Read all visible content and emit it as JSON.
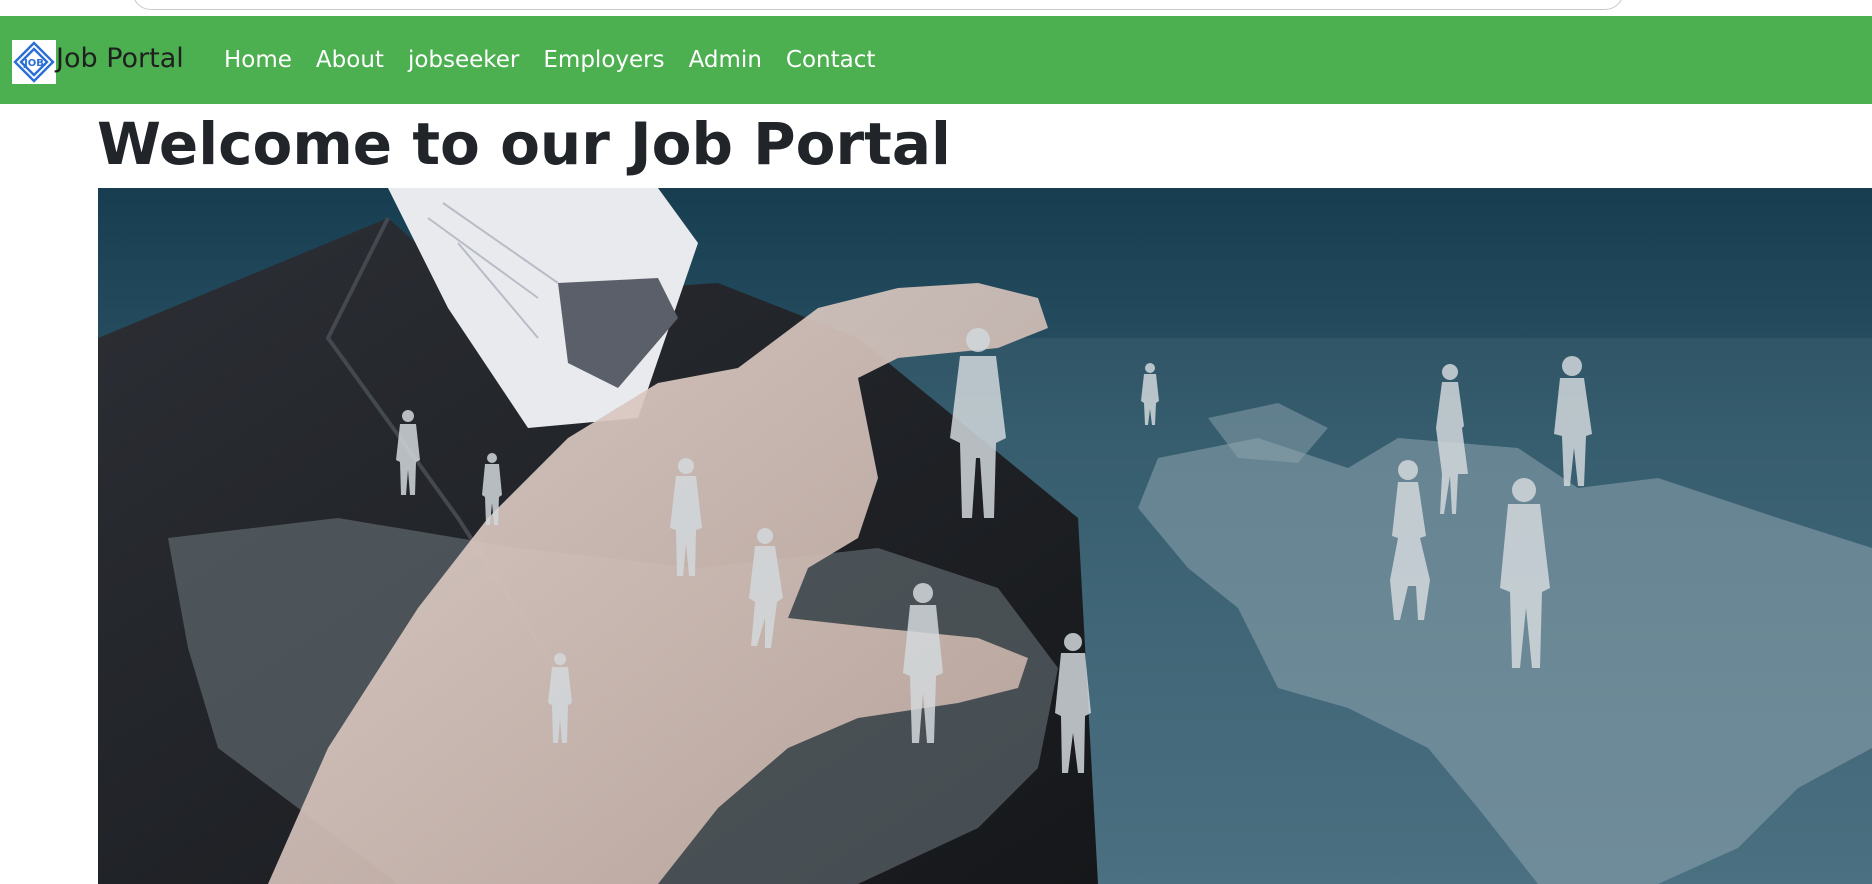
{
  "brand": {
    "name": "Job Portal",
    "logo_text": "JOB"
  },
  "nav": {
    "items": [
      {
        "label": "Home"
      },
      {
        "label": "About"
      },
      {
        "label": "jobseeker"
      },
      {
        "label": "Employers"
      },
      {
        "label": "Admin"
      },
      {
        "label": "Contact"
      }
    ]
  },
  "main": {
    "title": "Welcome to our Job Portal"
  },
  "colors": {
    "navbar_bg": "#4caf50",
    "nav_text": "#ffffff",
    "title_text": "#212529"
  }
}
